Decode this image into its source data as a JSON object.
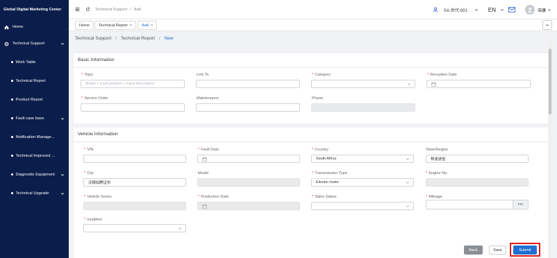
{
  "app": {
    "title": "Global Digital Marketing Center"
  },
  "sidebar": {
    "items": [
      {
        "label": "Home"
      },
      {
        "label": "Technical Support"
      },
      {
        "label": "Work Table"
      },
      {
        "label": "Technical Report"
      },
      {
        "label": "Product Report"
      },
      {
        "label": "Fault case base"
      },
      {
        "label": "Notification Manage..."
      },
      {
        "label": "Technical Improved ..."
      },
      {
        "label": "Diagnostic Equipment"
      },
      {
        "label": "Technical Upgrade"
      }
    ]
  },
  "header": {
    "crumb1": "Technical Support",
    "crumb_sep": "/",
    "crumb2": "Add",
    "org": "SA-世代-001",
    "lang": "EN",
    "user": "诺康"
  },
  "tabs": [
    {
      "label": "Home"
    },
    {
      "label": "Technical Report"
    },
    {
      "label": "Add"
    }
  ],
  "breadcrumb": {
    "sep": "/",
    "items": [
      "Technical Support",
      "Technical Report",
      "New"
    ]
  },
  "basic": {
    "title": "Basic Information",
    "topic": {
      "label": "Topic",
      "placeholder": "Model + Fault position + Fault Description"
    },
    "link_to": {
      "label": "Link To"
    },
    "category": {
      "label": "Category"
    },
    "reception_date": {
      "label": "Reception Date"
    },
    "service_order": {
      "label": "Service Order"
    },
    "maintenance": {
      "label": "Maintenance"
    },
    "phone": {
      "label": "Phone"
    }
  },
  "vehicle": {
    "title": "Vehicle Information",
    "vin": {
      "label": "VIN"
    },
    "fault_date": {
      "label": "Fault Date"
    },
    "country": {
      "label": "Country",
      "value": "South Africa"
    },
    "state_region": {
      "label": "State/Region",
      "value": "林波波省"
    },
    "city": {
      "label": "City",
      "value": "沃姆伯腾证市"
    },
    "model": {
      "label": "Model"
    },
    "transmission_type": {
      "label": "Transmission Type",
      "value": "Electric motor"
    },
    "engine_no": {
      "label": "Engine No."
    },
    "vehicle_series": {
      "label": "Vehicle Series"
    },
    "production_date": {
      "label": "Production Date"
    },
    "sales_status": {
      "label": "Sales Status"
    },
    "mileage": {
      "label": "Mileage",
      "unit": "km"
    },
    "modified": {
      "label": "modified"
    }
  },
  "required_mark": "*",
  "tab_close": "×",
  "actions": {
    "back": "Back",
    "save": "Save",
    "submit": "Submit"
  },
  "colors": {
    "sidebar_bg": "#0b1d4a",
    "primary": "#1f6fd1",
    "highlight_border": "#e01818"
  }
}
